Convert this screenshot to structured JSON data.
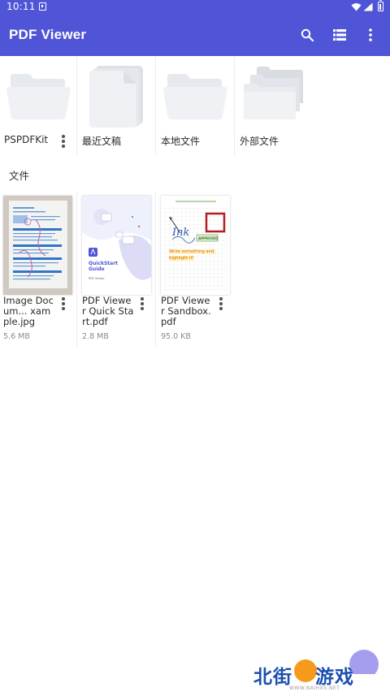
{
  "status_bar": {
    "time": "10:11"
  },
  "app_bar": {
    "title": "PDF Viewer",
    "icons": [
      "search-icon",
      "list-view-icon",
      "more-vert-icon"
    ]
  },
  "folders": [
    {
      "label": "PSPDFKit",
      "icon": "folder-icon",
      "has_menu": true
    },
    {
      "label": "最近文稿",
      "icon": "document-stack-icon",
      "has_menu": false
    },
    {
      "label": "本地文件",
      "icon": "folder-icon",
      "has_menu": false
    },
    {
      "label": "外部文件",
      "icon": "folder-stack-icon",
      "has_menu": false
    }
  ],
  "section_title": "文件",
  "files": [
    {
      "name": "Image Docum... xample.jpg",
      "size": "5.6 MB",
      "thumb": "scanned-document"
    },
    {
      "name": "PDF Viewer Quick Start.pdf",
      "size": "2.8 MB",
      "thumb": "quickstart-guide",
      "thumb_text": {
        "line1": "QuickStart",
        "line2": "Guide",
        "line3": "PDF Viewer"
      }
    },
    {
      "name": "PDF Viewer Sandbox.pdf",
      "size": "95.0 KB",
      "thumb": "sandbox-page",
      "thumb_text": {
        "ink": "Ink",
        "approved": "APPROVED",
        "write": "Write something and",
        "highlight": "highlight it!"
      }
    }
  ],
  "watermark": {
    "left": "北街",
    "right": "游戏",
    "url": "WWW.BAIHXS.NET"
  },
  "colors": {
    "primary": "#4F55D6",
    "folder": "#E6E9EE",
    "text": "#2b2b2b",
    "secondary_text": "#8a8a8a"
  }
}
